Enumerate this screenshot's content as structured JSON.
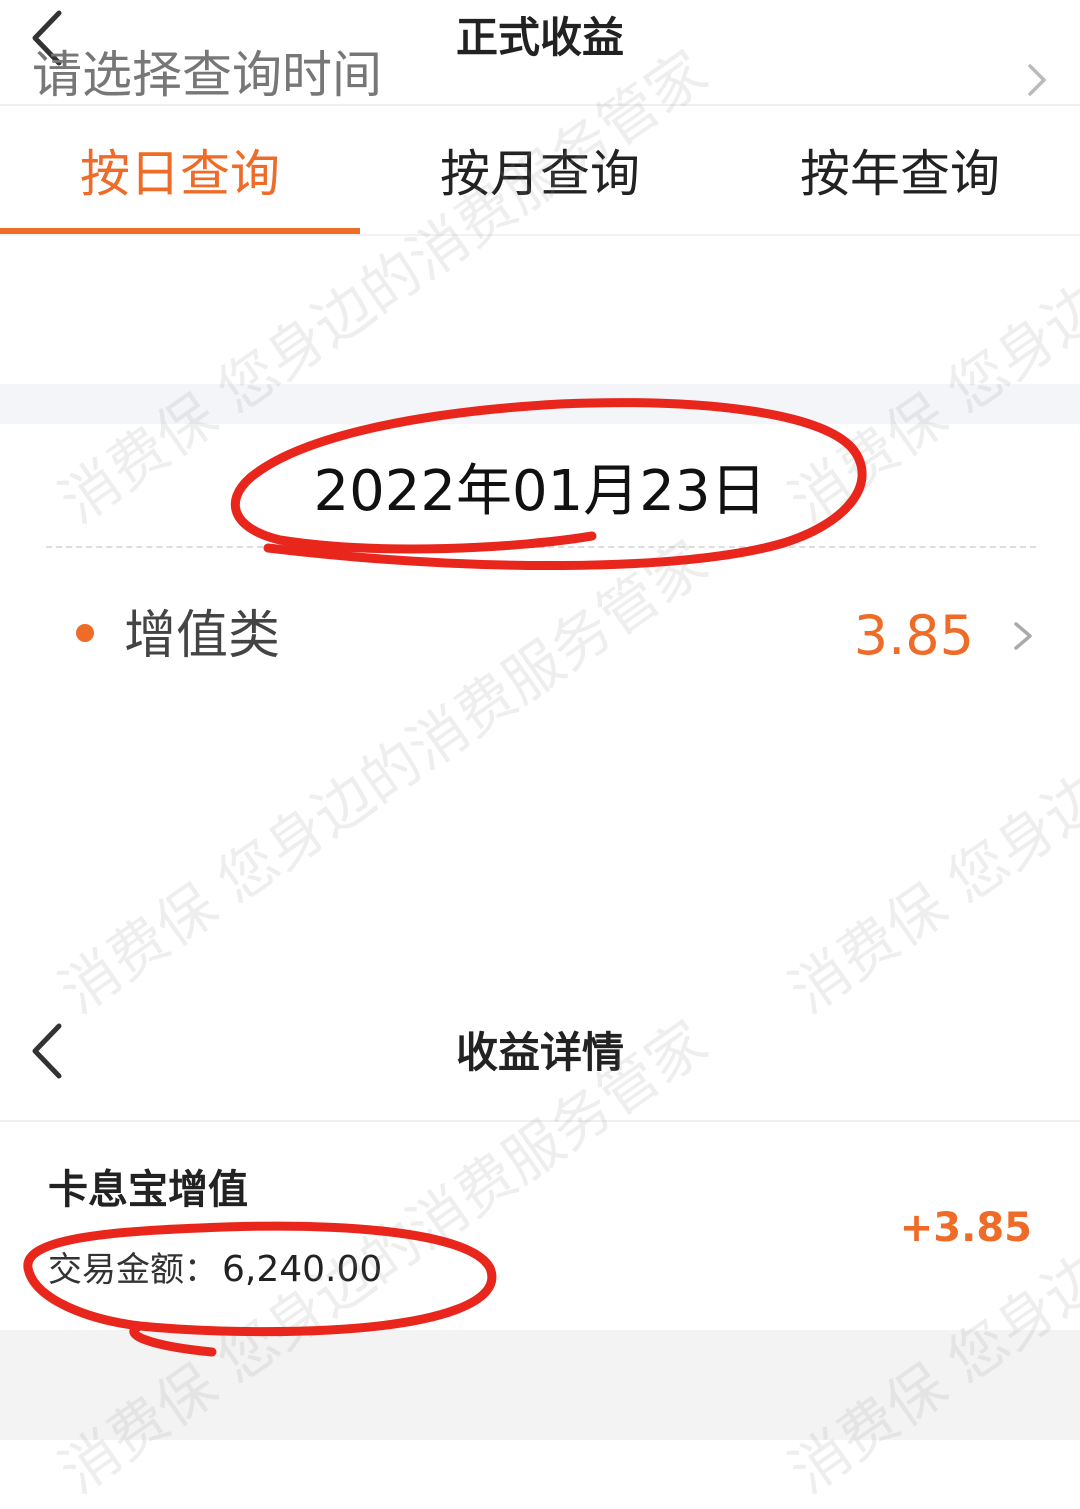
{
  "top_screen": {
    "title": "正式收益",
    "tabs": [
      {
        "label": "按日查询",
        "active": true
      },
      {
        "label": "按月查询",
        "active": false
      },
      {
        "label": "按年查询",
        "active": false
      }
    ],
    "time_picker": {
      "label": "请选择查询时间"
    },
    "date_heading": "2022年01月23日",
    "category": {
      "label": "增值类",
      "value": "3.85"
    }
  },
  "detail_screen": {
    "title": "收益详情",
    "item": {
      "name": "卡息宝增值",
      "amount_label": "交易金额：",
      "amount_value": "6,240.00",
      "income": "+3.85"
    }
  },
  "watermark": {
    "text": "消费保 您身边的消费服务管家"
  },
  "colors": {
    "accent": "#ee6b28",
    "annotation_red": "#e8261c",
    "separator_gray": "#f4f5f8"
  },
  "icons": [
    "chevron-left-icon",
    "chevron-right-icon",
    "bullet-dot-icon"
  ]
}
